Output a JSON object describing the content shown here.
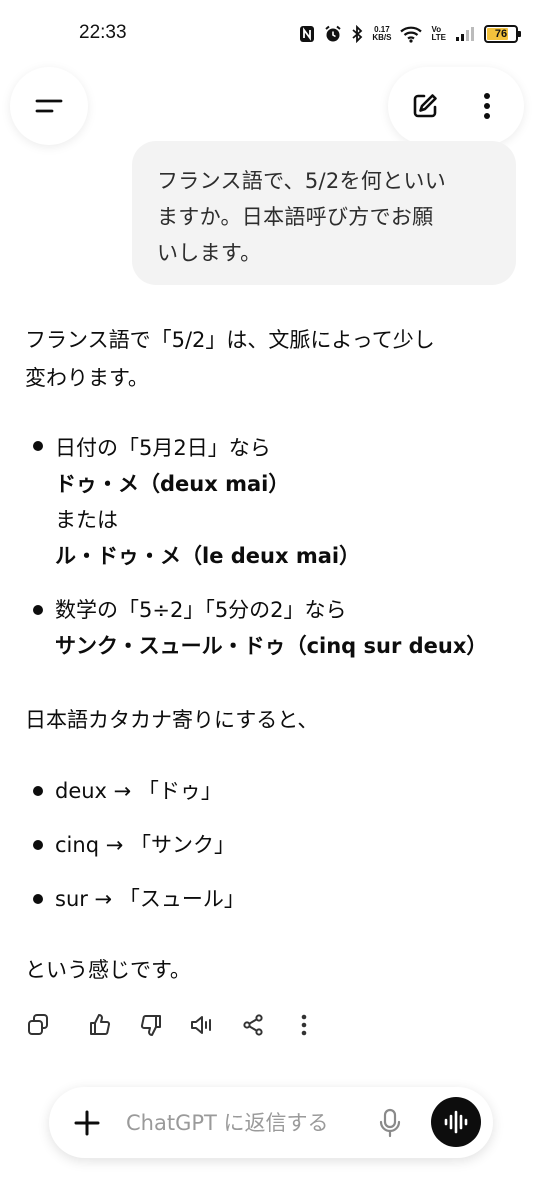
{
  "status_bar": {
    "time": "22:33",
    "net_speed_value": "0.17",
    "net_speed_unit": "KB/S",
    "volte_top": "Vo",
    "volte_bottom": "LTE",
    "battery_level": "76",
    "icons": [
      "nfc-icon",
      "alarm-icon",
      "bluetooth-icon",
      "wifi-icon",
      "signal-icon",
      "battery-icon"
    ]
  },
  "header": {
    "menu_icon": "menu-icon",
    "new_chat_icon": "edit-icon",
    "more_icon": "more-vertical-icon"
  },
  "user_message": {
    "lines": [
      "フランス語で、5/2を何といい",
      "ますか。日本語呼び方でお願",
      "いします。"
    ]
  },
  "assistant_message": {
    "intro_line1": "フランス語で「5/2」は、文脈によって少し",
    "intro_line2": "変わります。",
    "bullet1": {
      "line1": "日付の「5月2日」なら",
      "line2": "ドゥ・メ（deux mai）",
      "line3": "または",
      "line4": "ル・ドゥ・メ（le deux mai）"
    },
    "bullet2": {
      "line1": "数学の「5÷2」「5分の2」なら",
      "line2": "サンク・スュール・ドゥ（cinq sur deux）"
    },
    "katakana_intro": "日本語カタカナ寄りにすると、",
    "list": [
      "deux → 「ドゥ」",
      "cinq → 「サンク」",
      "sur → 「スュール」"
    ],
    "closing": "という感じです。"
  },
  "message_actions": {
    "icons": [
      "copy-icon",
      "thumbs-up-icon",
      "thumbs-down-icon",
      "speaker-icon",
      "share-icon",
      "more-vertical-icon"
    ]
  },
  "composer": {
    "placeholder": "ChatGPT に返信する",
    "plus_icon": "plus-icon",
    "mic_icon": "mic-icon",
    "voice_icon": "voice-mode-icon",
    "accent": "#0d0d0d"
  }
}
